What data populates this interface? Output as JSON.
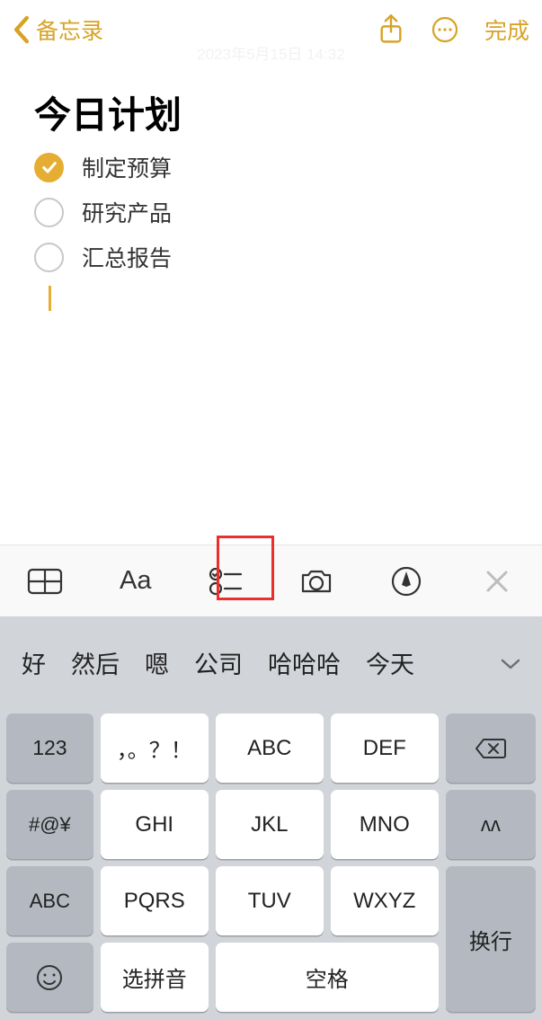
{
  "nav": {
    "back": "备忘录",
    "done": "完成"
  },
  "note": {
    "datestamp": "2023年5月15日 14:32",
    "title": "今日计划",
    "items": [
      {
        "checked": true,
        "text": "制定预算"
      },
      {
        "checked": false,
        "text": "研究产品"
      },
      {
        "checked": false,
        "text": "汇总报告"
      }
    ]
  },
  "format": {
    "aa": "Aa"
  },
  "keyboard": {
    "suggestions": [
      "好",
      "然后",
      "嗯",
      "公司",
      "哈哈哈",
      "今天"
    ],
    "left": [
      "123",
      "#@¥",
      "ABC"
    ],
    "grid": [
      "，。？！",
      "ABC",
      "DEF",
      "GHI",
      "JKL",
      "MNO",
      "PQRS",
      "TUV",
      "WXYZ"
    ],
    "bottom": {
      "select": "选拼音",
      "space": "空格"
    },
    "right": {
      "reinput": "ᴧᴧ",
      "enter": "换行"
    }
  },
  "colors": {
    "accent": "#d7a326"
  }
}
